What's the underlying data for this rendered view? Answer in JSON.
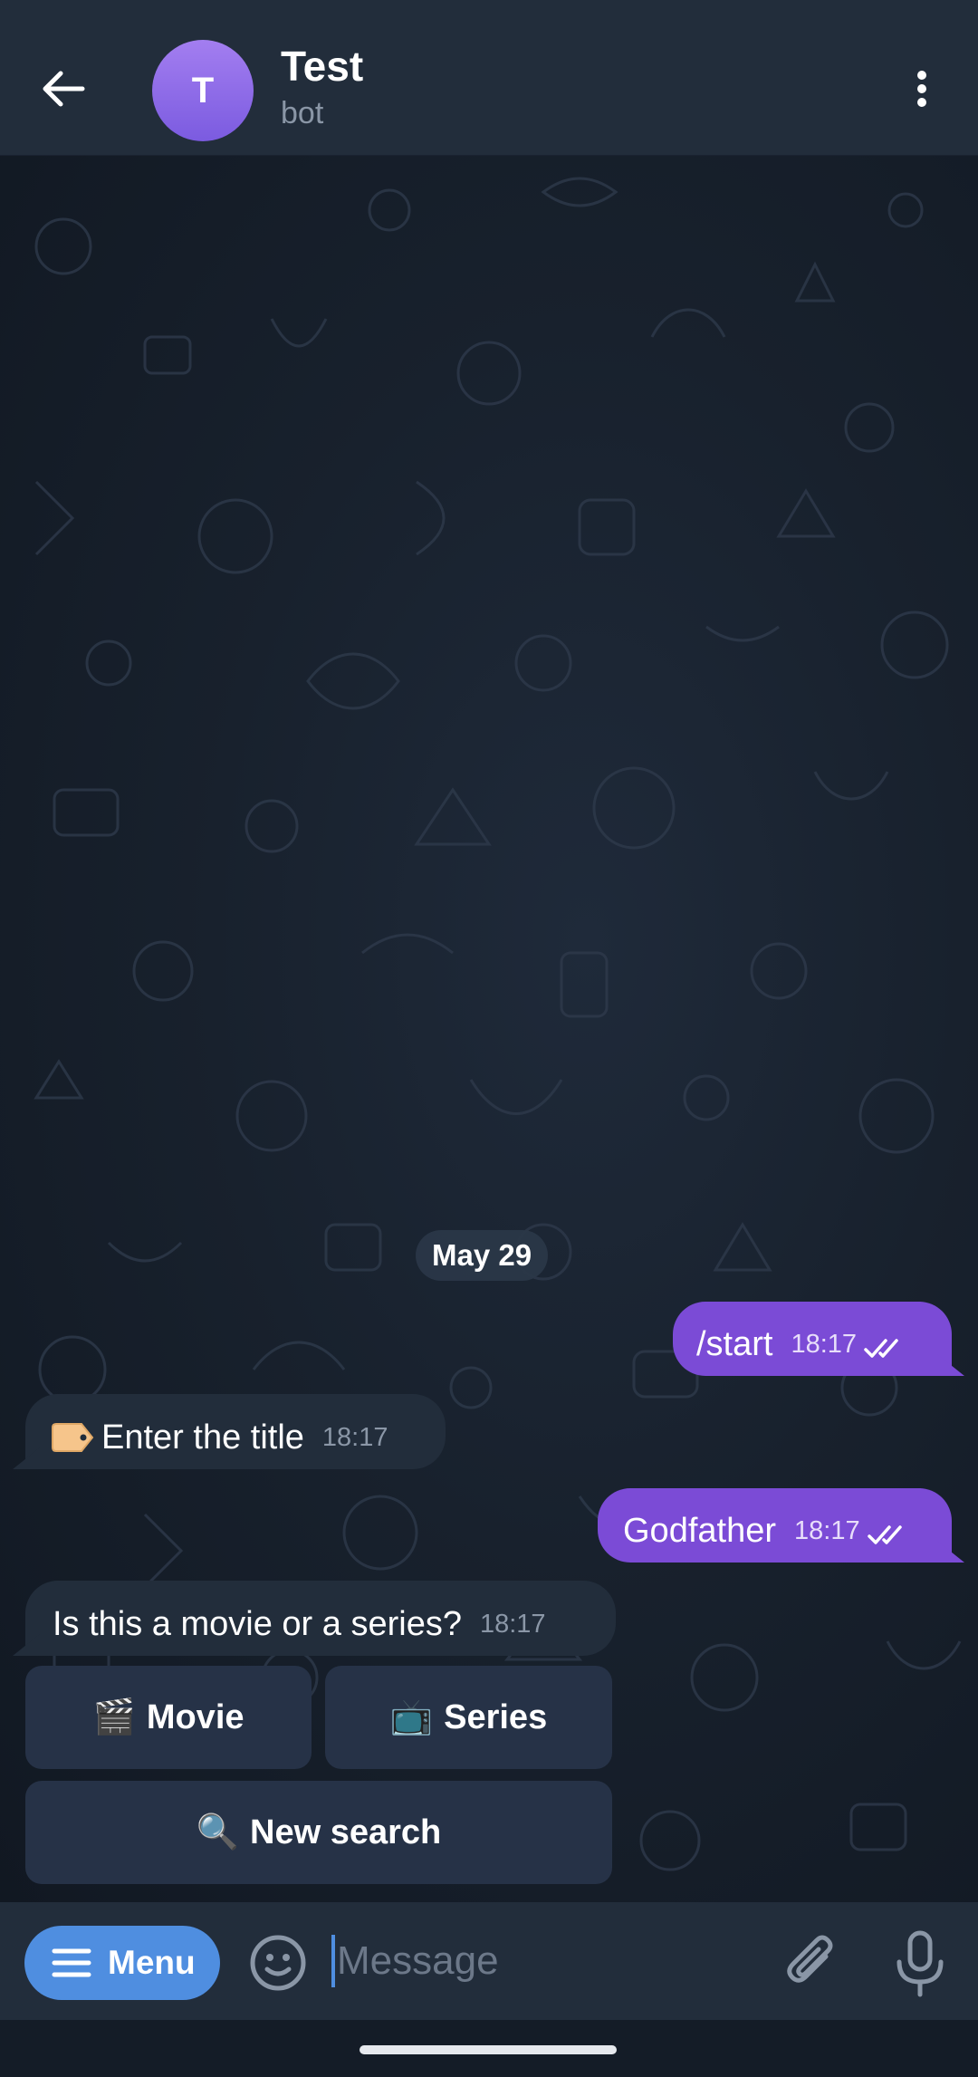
{
  "header": {
    "avatar_letter": "T",
    "title": "Test",
    "subtitle": "bot"
  },
  "chat": {
    "date_separator": "May 29",
    "messages": [
      {
        "direction": "out",
        "text": "/start",
        "time": "18:17",
        "status": "read"
      },
      {
        "direction": "in",
        "icon": "label-tag-emoji",
        "text": "Enter the title",
        "time": "18:17"
      },
      {
        "direction": "out",
        "text": "Godfather",
        "time": "18:17",
        "status": "read"
      },
      {
        "direction": "in",
        "text": "Is this a movie or a series?",
        "time": "18:17"
      }
    ],
    "inline_keyboard": [
      {
        "emoji": "🎬",
        "label": "Movie"
      },
      {
        "emoji": "📺",
        "label": "Series"
      },
      {
        "emoji": "🔍",
        "label": "New search"
      }
    ]
  },
  "input_bar": {
    "menu_label": "Menu",
    "placeholder": "Message"
  },
  "colors": {
    "header_bg": "#222d3b",
    "outgoing_bubble": "#7b4bd6",
    "incoming_bubble": "#222d3b",
    "keyboard_button": "#263247",
    "menu_button": "#4f8ee0",
    "avatar": "#8e6ce8"
  }
}
